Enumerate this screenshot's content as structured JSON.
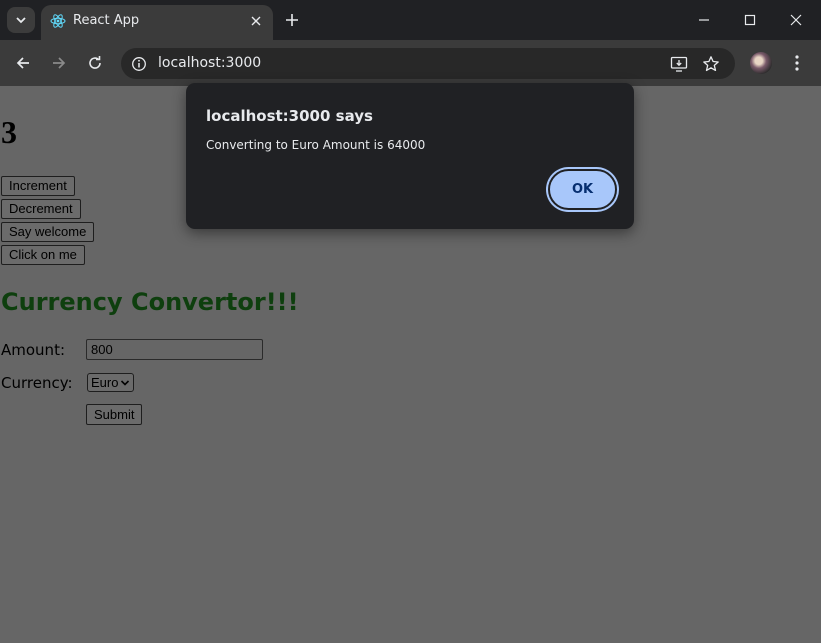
{
  "browser": {
    "tab_title": "React App",
    "url": "localhost:3000",
    "icons": {
      "tab_search": "chevron-down-icon",
      "favicon": "react-logo-icon",
      "tab_close": "close-icon",
      "new_tab": "plus-icon",
      "minimize": "minimize-icon",
      "maximize": "maximize-icon",
      "close": "close-icon",
      "back": "back-arrow-icon",
      "forward": "forward-arrow-icon",
      "reload": "reload-icon",
      "site_info": "info-icon",
      "install": "install-app-icon",
      "bookmark": "star-icon",
      "menu": "kebab-menu-icon"
    }
  },
  "page": {
    "counter": "3",
    "buttons": [
      "Increment",
      "Decrement",
      "Say welcome",
      "Click on me"
    ],
    "currency_title": "Currency Convertor!!!",
    "amount_label": "Amount:",
    "amount_value": "800",
    "currency_label": "Currency:",
    "currency_selected": "Euro",
    "submit_label": "Submit"
  },
  "dialog": {
    "title": "localhost:3000 says",
    "message": "Converting to Euro Amount is 64000",
    "ok_label": "OK"
  },
  "colors": {
    "page_overlay": "#666666",
    "heading_green": "#0e3f0e",
    "ok_button": "#a8c7fa",
    "dialog_bg": "#202124"
  }
}
